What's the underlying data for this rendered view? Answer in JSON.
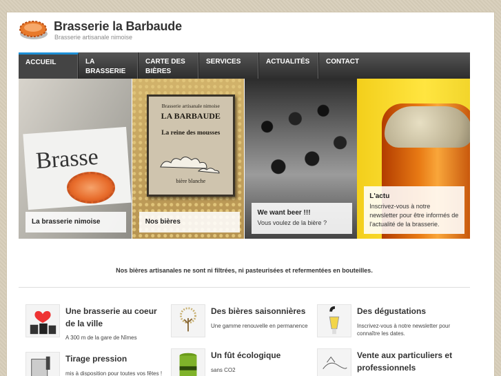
{
  "site": {
    "title": "Brasserie la Barbaude",
    "subtitle": "Brasserie artisanale nimoise"
  },
  "nav": [
    {
      "label": "ACCUEIL",
      "active": true
    },
    {
      "label": "LA BRASSERIE"
    },
    {
      "label": "CARTE DES BIÈRES"
    },
    {
      "label": "SERVICES"
    },
    {
      "label": "ACTUALITÉS"
    },
    {
      "label": "CONTACT"
    }
  ],
  "hero": {
    "p1": {
      "caption": "La brasserie nimoise",
      "sign": "Brasse"
    },
    "p2": {
      "caption": "Nos bières",
      "book": {
        "l1": "Brasserie artisanale nimoise",
        "l2": "LA BARBAUDE",
        "l3": "La reine des mousses",
        "l4": "bière blanche"
      }
    },
    "p3": {
      "title": "We want beer !!!",
      "text": "Vous voulez de la bière ?"
    },
    "p4": {
      "title": "L'actu",
      "text": "Inscrivez-vous à notre newsletter pour être informés de l'actualité de la brasserie."
    }
  },
  "tagline": "Nos bières artisanales ne sont ni filtrées, ni pasteurisées et refermentées en bouteilles.",
  "features": [
    {
      "title": "Une brasserie au coeur de la ville",
      "desc": "A 300 m de la gare de Nîmes"
    },
    {
      "title": "Des bières saisonnières",
      "desc": "Une gamme renouvelle en permanence"
    },
    {
      "title": "Des dégustations",
      "desc": "Inscrivez-vous à notre newsletter pour connaître les dates."
    },
    {
      "title": "Tirage pression",
      "desc": "mis à disposition pour toutes vos fêtes !"
    },
    {
      "title": "Un fût écologique",
      "desc": "sans CO2"
    },
    {
      "title": "Vente aux particuliers et professionnels",
      "desc": ""
    }
  ],
  "colors": {
    "accent": "#1d8fd6",
    "nav_bg": "#333333",
    "actu_bg": "#ffe540"
  }
}
